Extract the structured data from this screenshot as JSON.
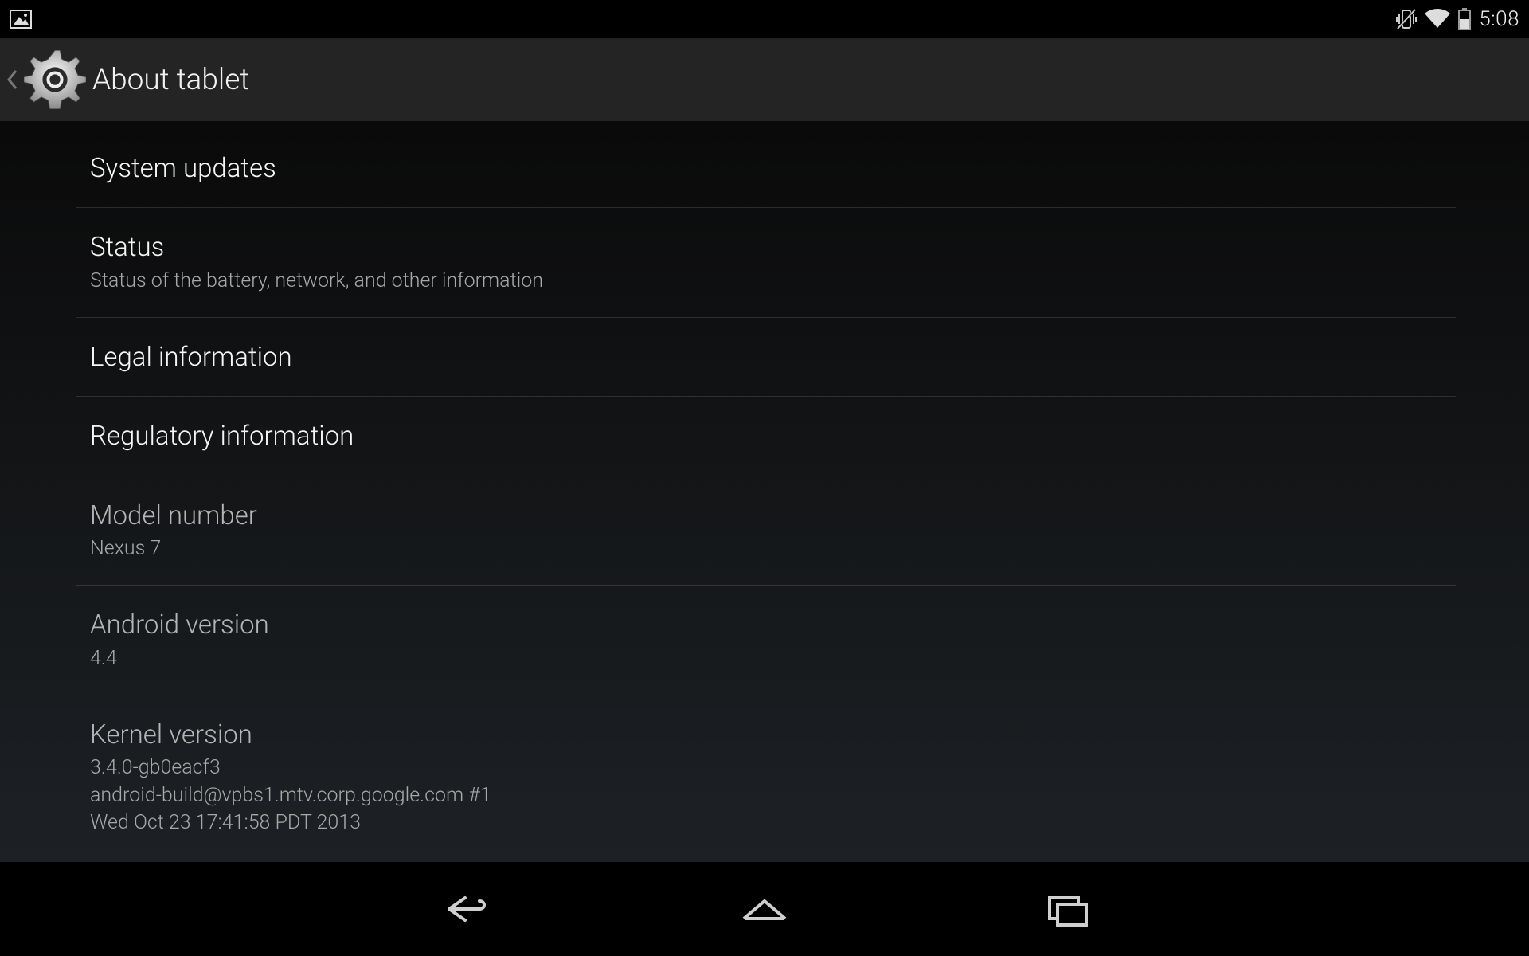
{
  "statusbar": {
    "time": "5:08"
  },
  "header": {
    "title": "About tablet"
  },
  "rows": [
    {
      "title": "System updates"
    },
    {
      "title": "Status",
      "sub": "Status of the battery, network, and other information"
    },
    {
      "title": "Legal information"
    },
    {
      "title": "Regulatory information"
    },
    {
      "title": "Model number",
      "sub": "Nexus 7",
      "dim": true
    },
    {
      "title": "Android version",
      "sub": "4.4",
      "dim": true
    },
    {
      "title": "Kernel version",
      "sub": "3.4.0-gb0eacf3\nandroid-build@vpbs1.mtv.corp.google.com #1\nWed Oct 23 17:41:58 PDT 2013",
      "dim": true
    }
  ]
}
